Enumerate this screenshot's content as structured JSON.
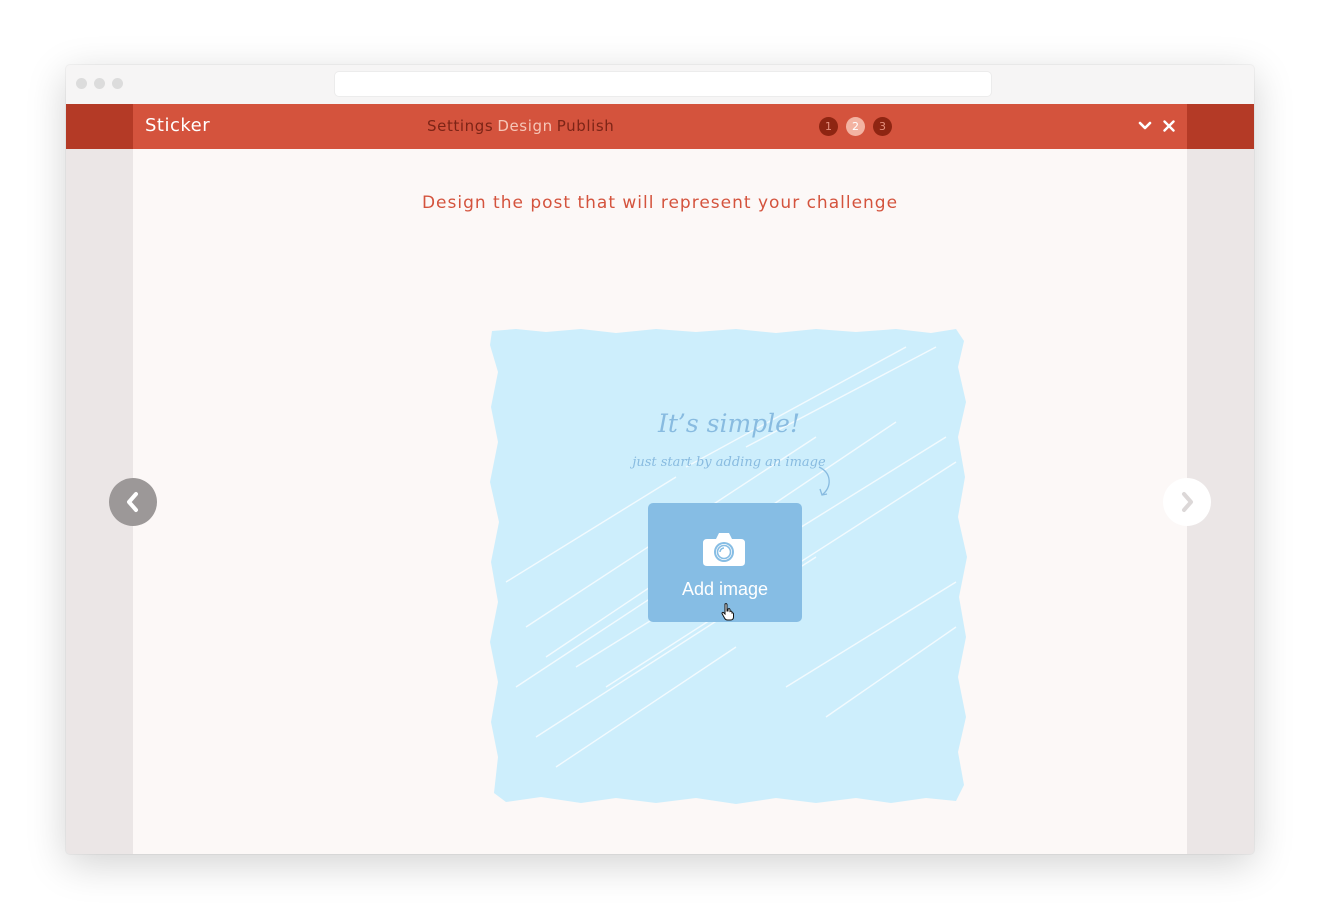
{
  "app": {
    "name": "Sticker"
  },
  "steps": {
    "labels": [
      "Settings",
      "Design",
      "Publish"
    ],
    "active_index": 1,
    "badges": [
      "1",
      "2",
      "3"
    ]
  },
  "window_controls": {
    "icons": [
      "chevron-down-icon",
      "close-icon"
    ]
  },
  "main": {
    "headline": "Design the post that will represent your challenge",
    "canvas": {
      "title": "It’s simple!",
      "subtitle": "just start by adding an image",
      "add_button_label": "Add image"
    }
  },
  "navigation": {
    "prev_icon": "chevron-left-icon",
    "next_icon": "chevron-right-icon"
  },
  "colors": {
    "brand": "#d4533d",
    "brand_dark": "#b43a26",
    "canvas_blue": "#cdeefc",
    "button_blue": "#86bde4",
    "text_blue": "#88bbe0"
  }
}
